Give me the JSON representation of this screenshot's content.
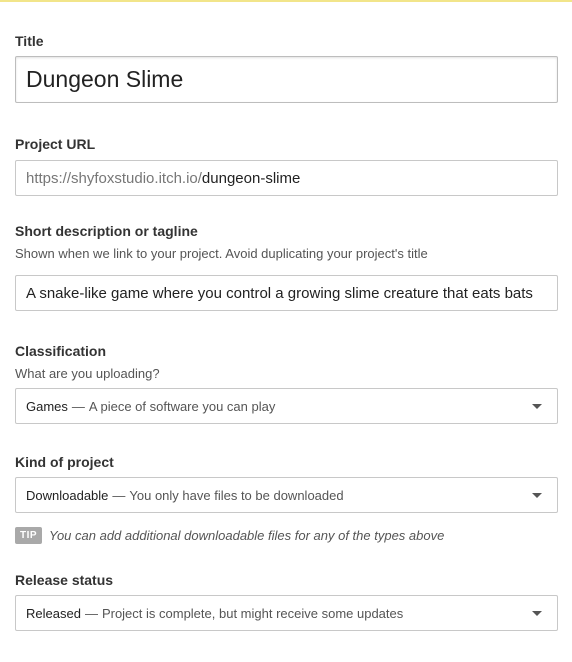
{
  "title_section": {
    "label": "Title",
    "value": "Dungeon Slime"
  },
  "url_section": {
    "label": "Project URL",
    "prefix": "https://shyfoxstudio.itch.io/",
    "slug": "dungeon-slime"
  },
  "tagline_section": {
    "label": "Short description or tagline",
    "help": "Shown when we link to your project. Avoid duplicating your project's title",
    "value": "A snake-like game where you control a growing slime creature that eats bats"
  },
  "classification_section": {
    "label": "Classification",
    "help": "What are you uploading?",
    "selected_main": "Games",
    "dash": "—",
    "selected_desc": "A piece of software you can play"
  },
  "kind_section": {
    "label": "Kind of project",
    "selected_main": "Downloadable",
    "dash": "—",
    "selected_desc": "You only have files to be downloaded"
  },
  "tip": {
    "badge": "TIP",
    "text": "You can add additional downloadable files for any of the types above"
  },
  "release_section": {
    "label": "Release status",
    "selected_main": "Released",
    "dash": "—",
    "selected_desc": "Project is complete, but might receive some updates"
  },
  "icons": {
    "dropdown": "chevron-down-icon"
  },
  "colors": {
    "top_bar": "#f2e58a",
    "tip_badge": "#a9a9a9"
  }
}
